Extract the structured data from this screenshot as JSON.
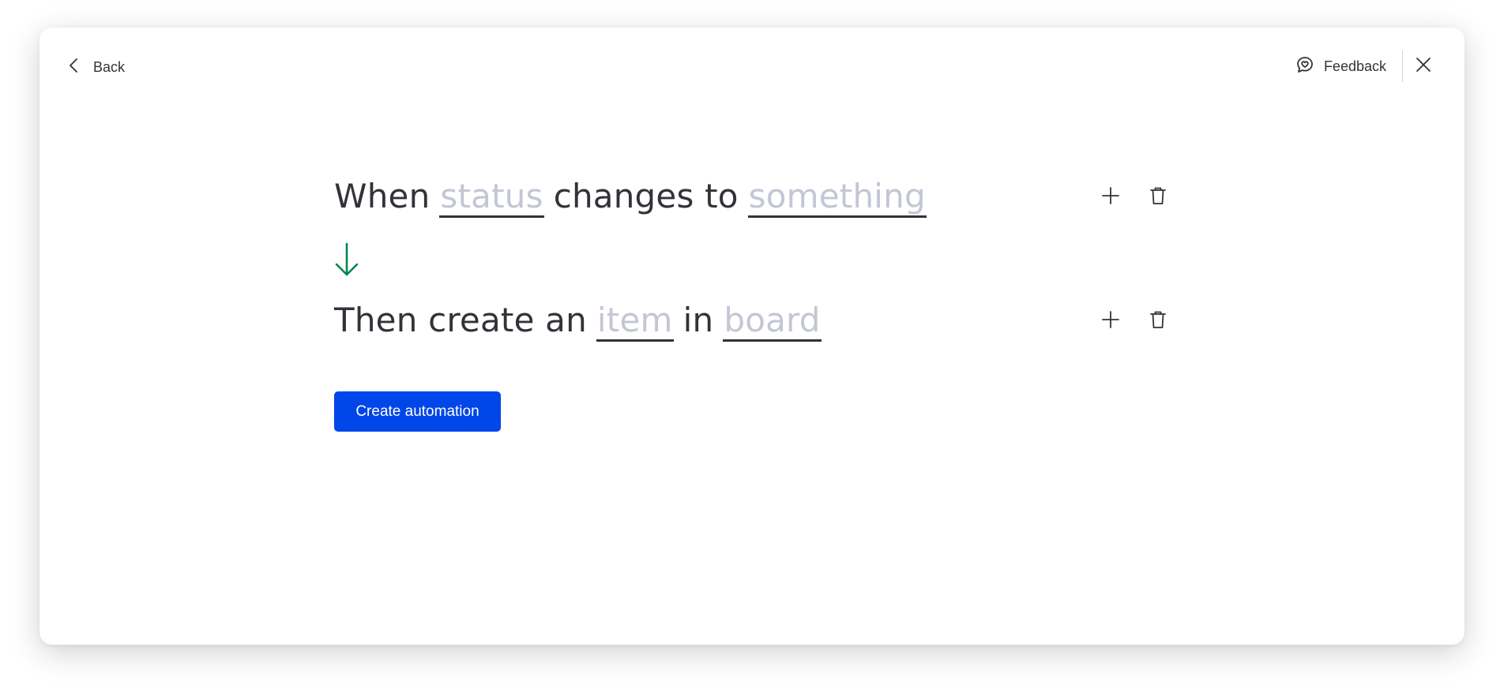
{
  "header": {
    "back_label": "Back",
    "feedback_label": "Feedback"
  },
  "trigger": {
    "words": [
      "When",
      "status",
      "changes to",
      "something"
    ],
    "when": "When",
    "field1": "status",
    "connector": "changes to",
    "field2": "something"
  },
  "action": {
    "lead": "Then create an",
    "field1": "item",
    "connector": "in",
    "field2": "board"
  },
  "create_button_label": "Create automation",
  "colors": {
    "primary": "#0046e8",
    "arrow": "#00854d",
    "text": "#323338",
    "placeholder": "#c3c6d4"
  }
}
